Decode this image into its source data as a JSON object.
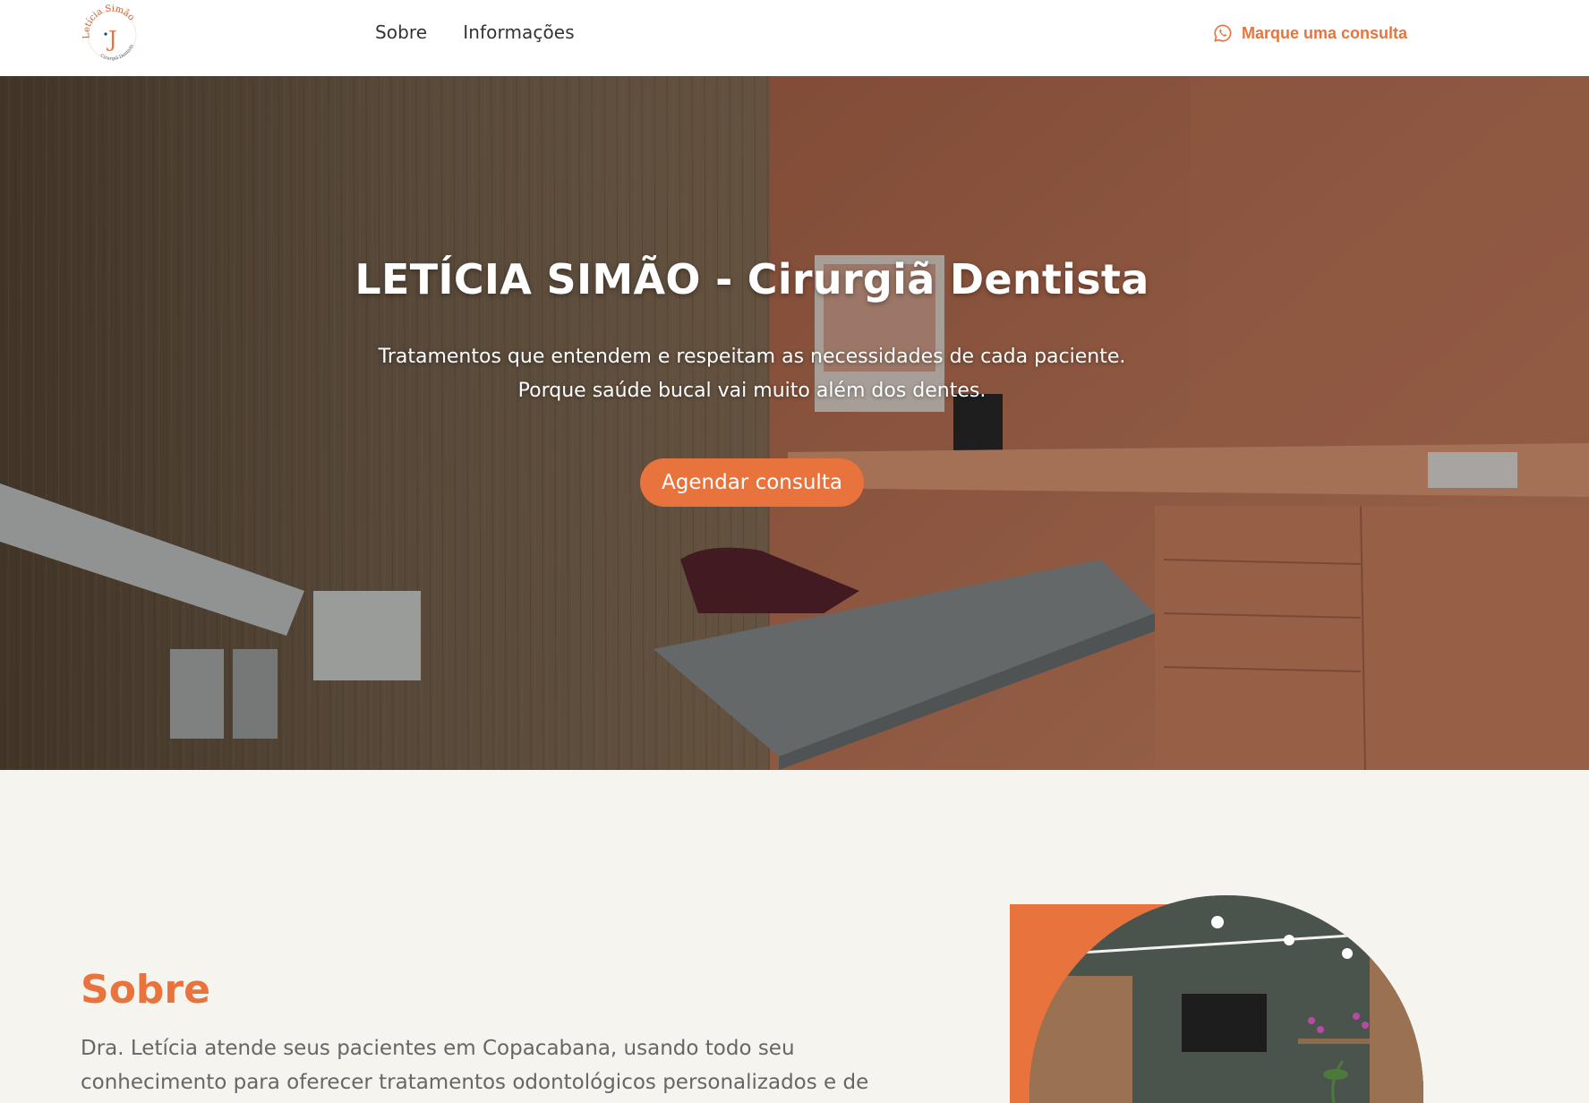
{
  "header": {
    "logo": {
      "text_top": "Letícia Simão",
      "text_bottom": "Cirurgiã Dentista",
      "monogram": "J"
    },
    "nav": [
      {
        "label": "Sobre"
      },
      {
        "label": "Informações"
      }
    ],
    "cta": {
      "label": "Marque uma consulta",
      "icon": "whatsapp-icon"
    }
  },
  "hero": {
    "title": "LETÍCIA SIMÃO - Cirurgiã Dentista",
    "subtitle_line1": "Tratamentos que entendem e respeitam as necessidades de cada paciente.",
    "subtitle_line2": "Porque saúde bucal vai muito além dos dentes.",
    "button_label": "Agendar consulta"
  },
  "about": {
    "title": "Sobre",
    "text_line1": "Dra. Letícia atende seus pacientes em Copacabana, usando todo seu",
    "text_line2": "conhecimento para oferecer tratamentos odontológicos personalizados e de"
  },
  "colors": {
    "accent": "#e8733c",
    "background": "#f6f4ef",
    "header_bg": "#ffffff",
    "nav_text": "#333333",
    "body_text": "#666666"
  }
}
